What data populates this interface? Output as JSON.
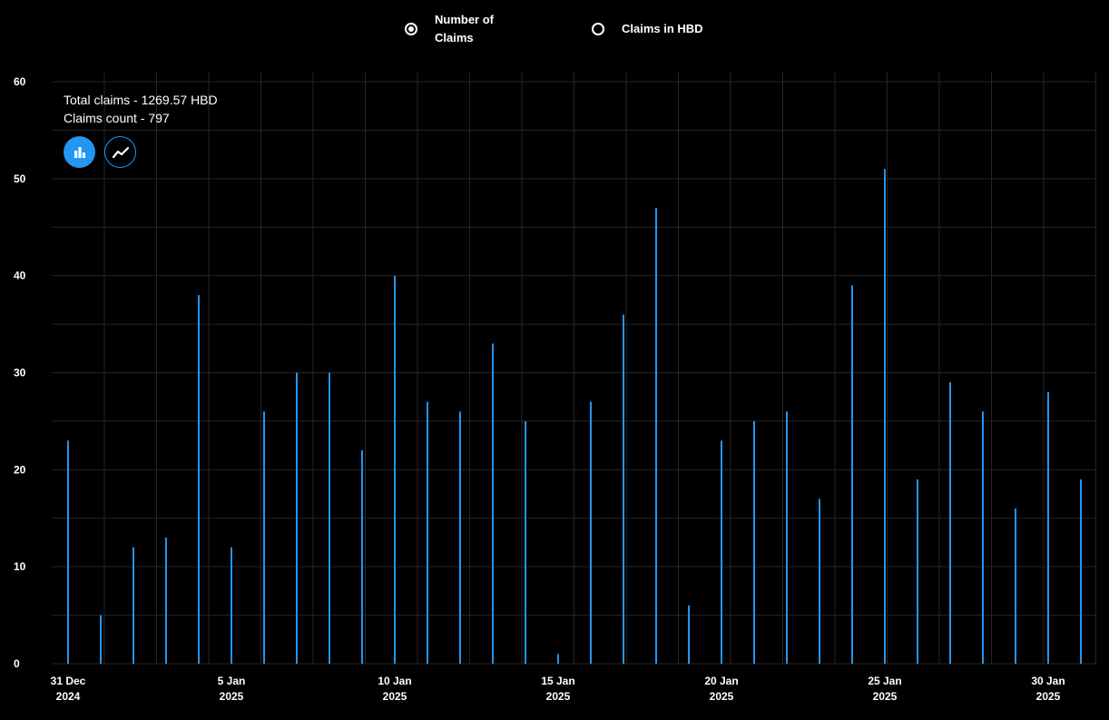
{
  "legend": {
    "items": [
      {
        "label": "Number of Claims",
        "selected": true
      },
      {
        "label": "Claims in HBD",
        "selected": false
      }
    ]
  },
  "summary": {
    "total": "Total claims - 1269.57 HBD",
    "count": "Claims count - 797"
  },
  "controls": {
    "bar_icon": "bar-chart-icon",
    "line_icon": "line-chart-icon"
  },
  "colors": {
    "bar": "#2196f3",
    "background": "#000000",
    "grid": "#262626"
  },
  "chart_data": {
    "type": "bar",
    "x": [
      "2024-12-31",
      "2025-01-01",
      "2025-01-02",
      "2025-01-03",
      "2025-01-04",
      "2025-01-05",
      "2025-01-06",
      "2025-01-07",
      "2025-01-08",
      "2025-01-09",
      "2025-01-10",
      "2025-01-11",
      "2025-01-12",
      "2025-01-13",
      "2025-01-14",
      "2025-01-15",
      "2025-01-16",
      "2025-01-17",
      "2025-01-18",
      "2025-01-19",
      "2025-01-20",
      "2025-01-21",
      "2025-01-22",
      "2025-01-23",
      "2025-01-24",
      "2025-01-25",
      "2025-01-26",
      "2025-01-27",
      "2025-01-28",
      "2025-01-29",
      "2025-01-30",
      "2025-01-31"
    ],
    "values": [
      23,
      5,
      12,
      13,
      38,
      12,
      26,
      30,
      30,
      22,
      40,
      27,
      26,
      33,
      25,
      1,
      27,
      36,
      47,
      6,
      23,
      25,
      26,
      17,
      39,
      51,
      19,
      29,
      26,
      16,
      28,
      19
    ],
    "ylim": [
      0,
      60
    ],
    "yticks": [
      0,
      10,
      20,
      30,
      40,
      50,
      60
    ],
    "xticks": [
      {
        "date": "2024-12-31",
        "line1": "31 Dec",
        "line2": "2024"
      },
      {
        "date": "2025-01-05",
        "line1": "5 Jan",
        "line2": "2025"
      },
      {
        "date": "2025-01-10",
        "line1": "10 Jan",
        "line2": "2025"
      },
      {
        "date": "2025-01-15",
        "line1": "15 Jan",
        "line2": "2025"
      },
      {
        "date": "2025-01-20",
        "line1": "20 Jan",
        "line2": "2025"
      },
      {
        "date": "2025-01-25",
        "line1": "25 Jan",
        "line2": "2025"
      },
      {
        "date": "2025-01-30",
        "line1": "30 Jan",
        "line2": "2025"
      }
    ],
    "grid": true,
    "title": "",
    "xlabel": "",
    "ylabel": ""
  }
}
